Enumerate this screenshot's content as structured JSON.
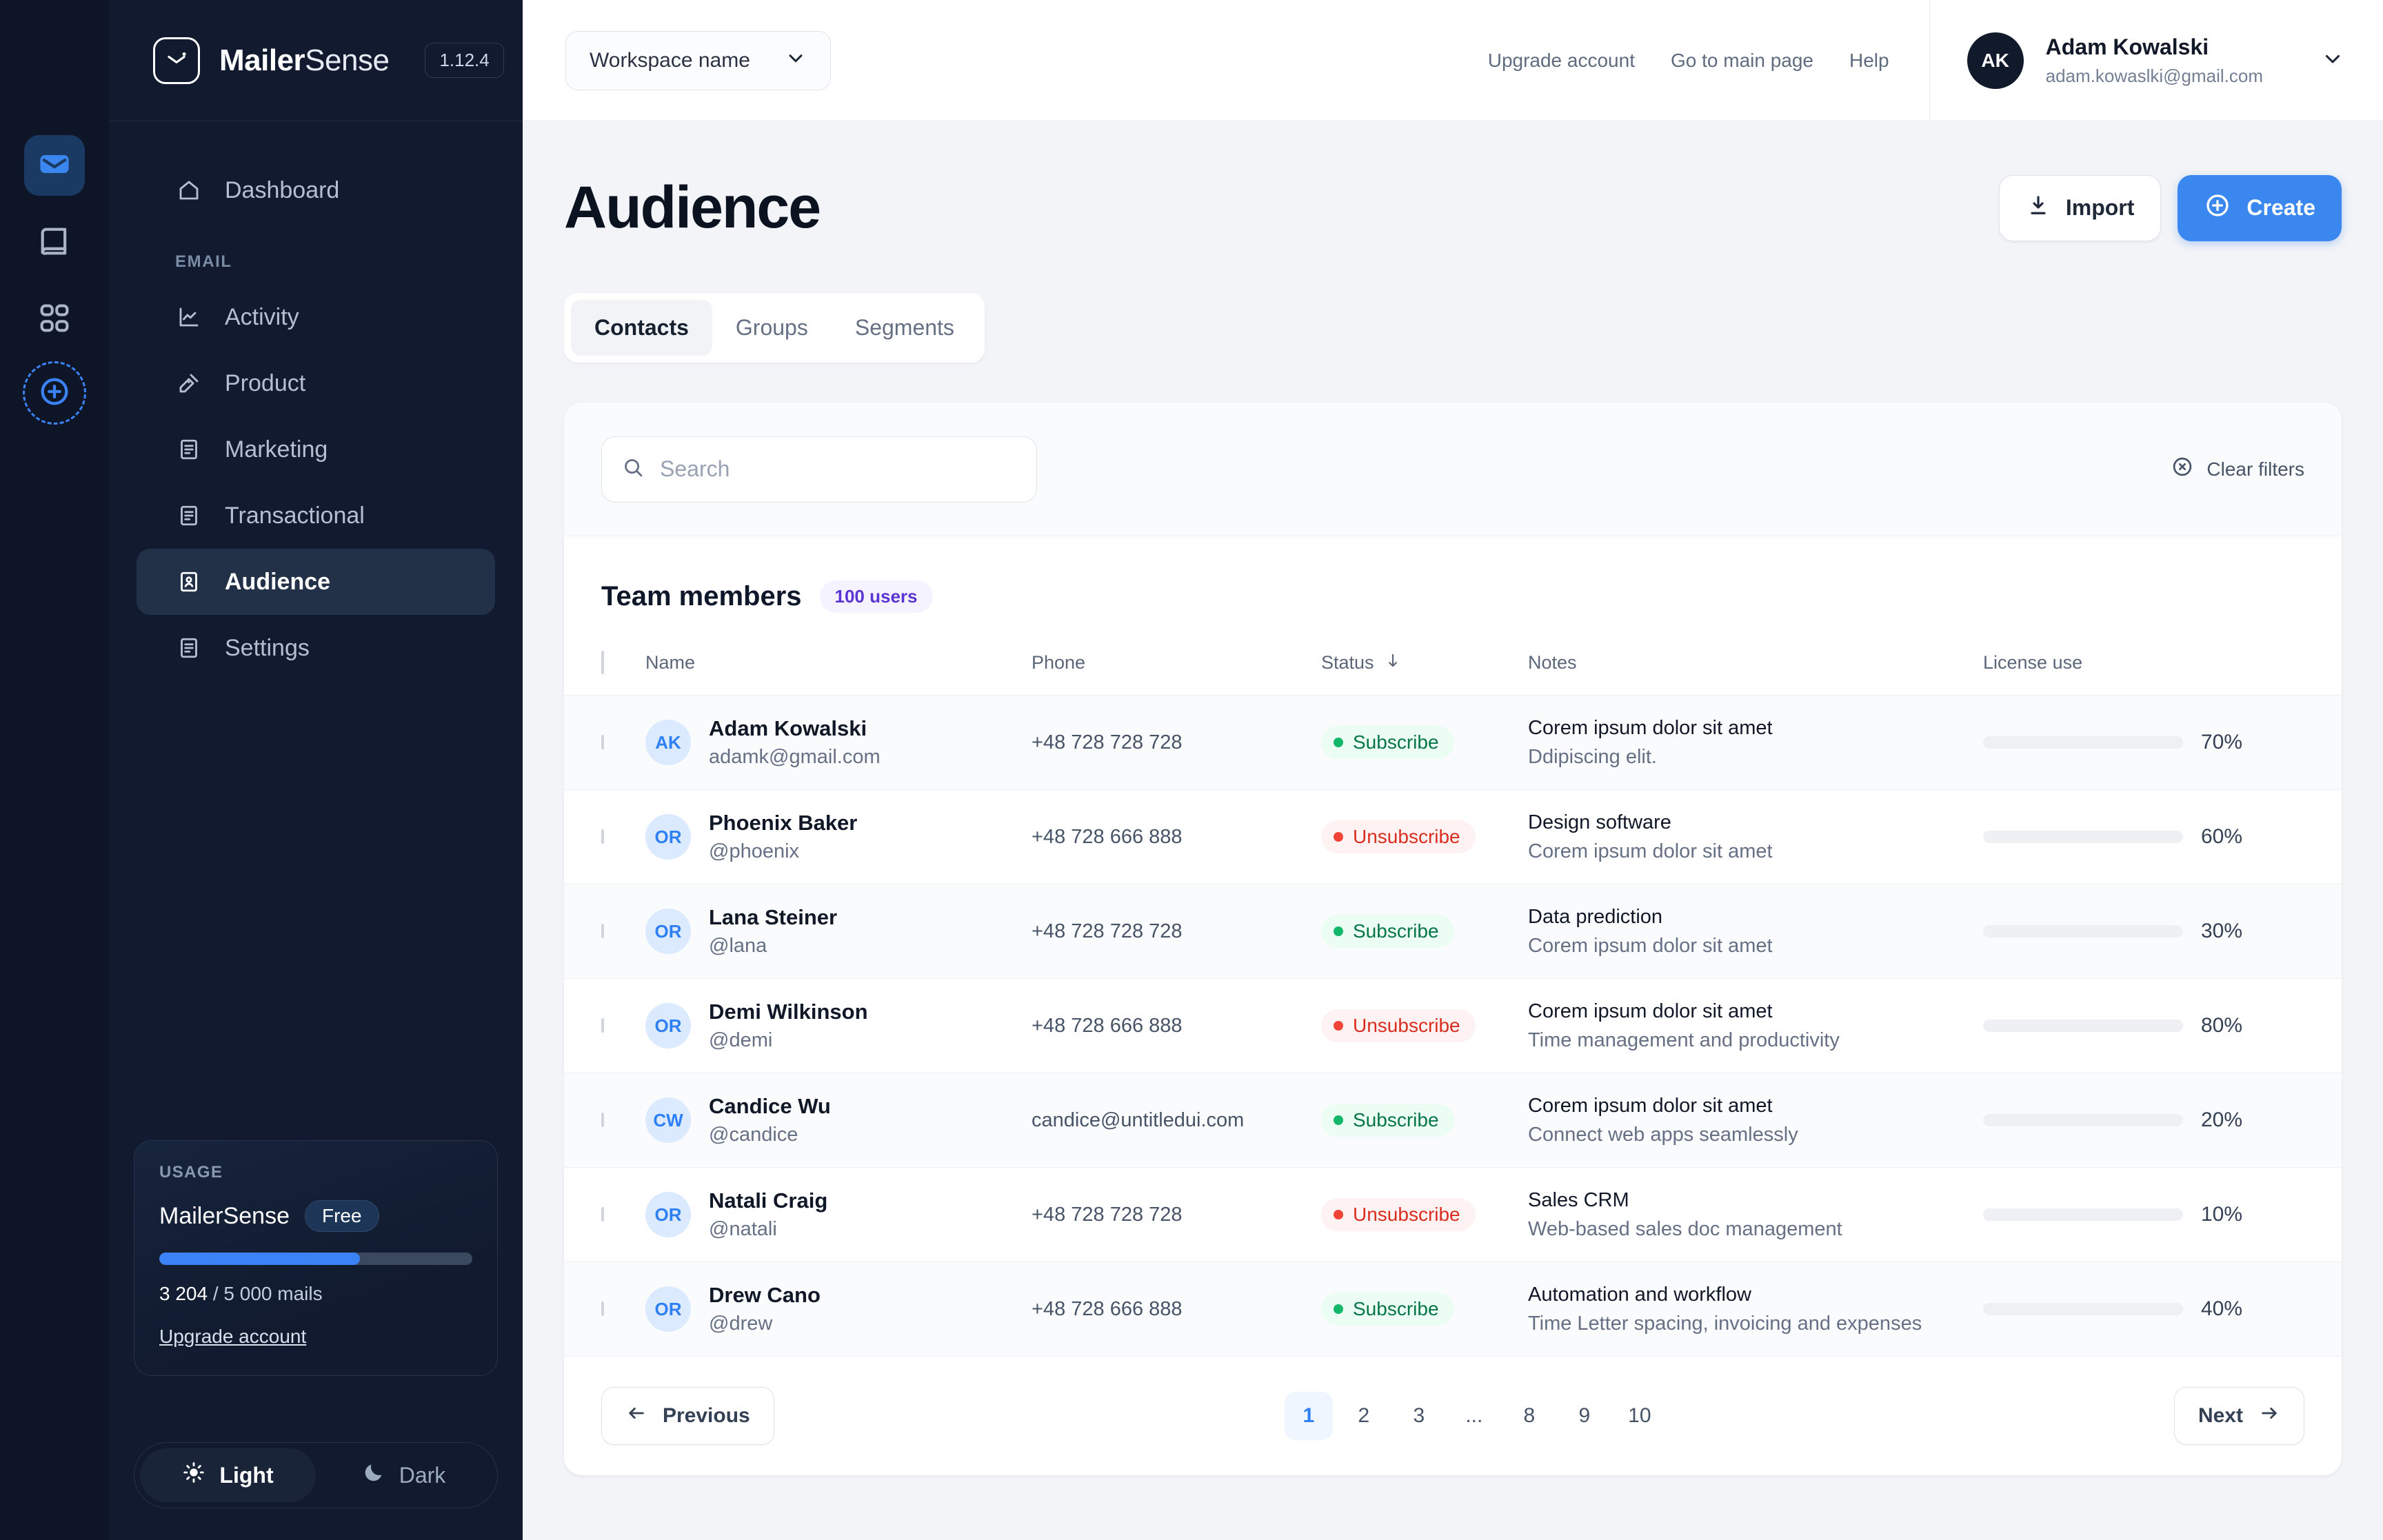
{
  "rail": {
    "items": [
      {
        "icon": "mail-icon",
        "active": true
      },
      {
        "icon": "book-icon",
        "active": false
      },
      {
        "icon": "grid-apps-icon",
        "active": false
      }
    ],
    "add_label": "plus-circle-icon"
  },
  "brand": {
    "name_bold": "Mailer",
    "name_light": "Sense",
    "version": "1.12.4"
  },
  "sidebar": {
    "top_items": [
      {
        "label": "Dashboard",
        "icon": "home-icon",
        "active": false
      }
    ],
    "section_label": "EMAIL",
    "items": [
      {
        "label": "Activity",
        "icon": "chart-line-icon",
        "active": false
      },
      {
        "label": "Product",
        "icon": "tools-icon",
        "active": false
      },
      {
        "label": "Marketing",
        "icon": "file-list-icon",
        "active": false
      },
      {
        "label": "Transactional",
        "icon": "file-list-icon",
        "active": false
      },
      {
        "label": "Audience",
        "icon": "contact-card-icon",
        "active": true
      },
      {
        "label": "Settings",
        "icon": "file-list-icon",
        "active": false
      }
    ],
    "usage": {
      "kicker": "USAGE",
      "plan_name": "MailerSense",
      "plan_chip": "Free",
      "used": "3 204",
      "separator": "/",
      "limit": "5 000 mails",
      "progress_pct": 64,
      "upgrade_label": "Upgrade account"
    },
    "theme": {
      "light_label": "Light",
      "dark_label": "Dark",
      "selected": "Light"
    }
  },
  "topbar": {
    "workspace_label": "Workspace name",
    "links": [
      {
        "label": "Upgrade account"
      },
      {
        "label": "Go to main page"
      },
      {
        "label": "Help"
      }
    ],
    "user": {
      "initials": "AK",
      "name": "Adam Kowalski",
      "email": "adam.kowaslki@gmail.com"
    }
  },
  "page": {
    "title": "Audience",
    "import_label": "Import",
    "create_label": "Create",
    "tabs": [
      {
        "label": "Contacts",
        "active": true
      },
      {
        "label": "Groups",
        "active": false
      },
      {
        "label": "Segments",
        "active": false
      }
    ]
  },
  "filters": {
    "search_placeholder": "Search",
    "search_value": "",
    "clear_label": "Clear filters"
  },
  "table": {
    "title": "Team members",
    "count_badge": "100 users",
    "columns": [
      {
        "label": "Name"
      },
      {
        "label": "Phone"
      },
      {
        "label": "Status",
        "sort": "desc"
      },
      {
        "label": "Notes"
      },
      {
        "label": "License use"
      }
    ],
    "rows": [
      {
        "initials": "AK",
        "name": "Adam Kowalski",
        "handle": "adamk@gmail.com",
        "phone": "+48 728 728 728",
        "status": "Subscribe",
        "status_kind": "sub",
        "note_main": "Corem ipsum dolor sit amet",
        "note_sub": "Ddipiscing elit.",
        "license_pct": 70,
        "license_label": "70%"
      },
      {
        "initials": "OR",
        "name": "Phoenix Baker",
        "handle": "@phoenix",
        "phone": "+48 728 666 888",
        "status": "Unsubscribe",
        "status_kind": "unsub",
        "note_main": "Design software",
        "note_sub": "Corem ipsum dolor sit amet",
        "license_pct": 60,
        "license_label": "60%"
      },
      {
        "initials": "OR",
        "name": "Lana Steiner",
        "handle": "@lana",
        "phone": "+48 728 728 728",
        "status": "Subscribe",
        "status_kind": "sub",
        "note_main": "Data prediction",
        "note_sub": "Corem ipsum dolor sit amet",
        "license_pct": 30,
        "license_label": "30%"
      },
      {
        "initials": "OR",
        "name": "Demi Wilkinson",
        "handle": "@demi",
        "phone": "+48 728 666 888",
        "status": "Unsubscribe",
        "status_kind": "unsub",
        "note_main": "Corem ipsum dolor sit amet",
        "note_sub": "Time management and productivity",
        "license_pct": 80,
        "license_label": "80%"
      },
      {
        "initials": "CW",
        "name": "Candice Wu",
        "handle": "@candice",
        "phone": "candice@untitledui.com",
        "status": "Subscribe",
        "status_kind": "sub",
        "note_main": "Corem ipsum dolor sit amet",
        "note_sub": "Connect web apps seamlessly",
        "license_pct": 20,
        "license_label": "20%"
      },
      {
        "initials": "OR",
        "name": "Natali Craig",
        "handle": "@natali",
        "phone": "+48 728 728 728",
        "status": "Unsubscribe",
        "status_kind": "unsub",
        "note_main": "Sales CRM",
        "note_sub": "Web-based sales doc management",
        "license_pct": 10,
        "license_label": "10%"
      },
      {
        "initials": "OR",
        "name": "Drew Cano",
        "handle": "@drew",
        "phone": "+48 728 666 888",
        "status": "Subscribe",
        "status_kind": "sub",
        "note_main": "Automation and workflow",
        "note_sub": "Time Letter spacing, invoicing and expenses",
        "license_pct": 40,
        "license_label": "40%"
      }
    ]
  },
  "pagination": {
    "previous_label": "Previous",
    "next_label": "Next",
    "pages": [
      "1",
      "2",
      "3",
      "...",
      "8",
      "9",
      "10"
    ],
    "current": "1"
  },
  "colors": {
    "accent": "#3b87f0",
    "sidebar_bg": "#111a2e",
    "rail_bg": "#0d1526",
    "success": "#12b76a",
    "danger": "#f04438",
    "badge_purple": "#5b34d4"
  }
}
